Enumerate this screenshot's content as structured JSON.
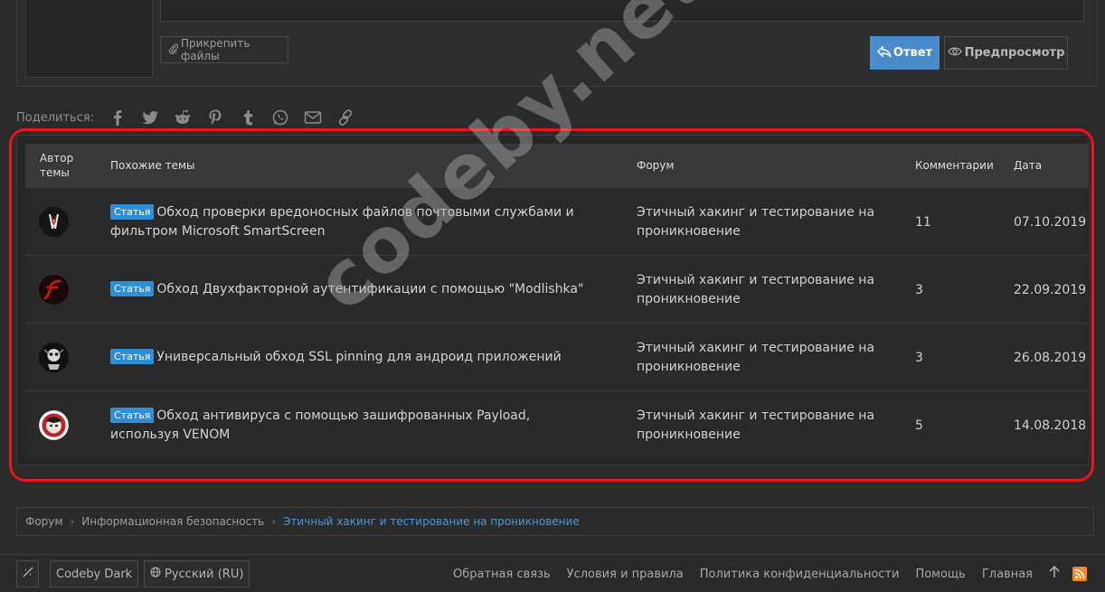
{
  "reply": {
    "attach_label": "Прикрепить файлы",
    "reply_label": "Ответ",
    "preview_label": "Предпросмотр"
  },
  "share": {
    "label": "Поделиться:",
    "icons": [
      "facebook-icon",
      "twitter-icon",
      "reddit-icon",
      "pinterest-icon",
      "tumblr-icon",
      "whatsapp-icon",
      "email-icon",
      "link-icon"
    ]
  },
  "similar": {
    "headers": {
      "author": "Автор темы",
      "title": "Похожие темы",
      "forum": "Форум",
      "comments": "Комментарии",
      "date": "Дата"
    },
    "rows": [
      {
        "prefix": "Статья",
        "title": "Обход проверки вредоносных файлов почтовыми службами и фильтром Microsoft SmartScreen",
        "forum": "Этичный хакинг и тестирование на проникновение",
        "comments": "11",
        "date": "07.10.2019"
      },
      {
        "prefix": "Статья",
        "title": "Обход Двухфакторной аутентификации с помощью \"Modlishka\"",
        "forum": "Этичный хакинг и тестирование на проникновение",
        "comments": "3",
        "date": "22.09.2019"
      },
      {
        "prefix": "Статья",
        "title": "Универсальный обход SSL pinning для андроид приложений",
        "forum": "Этичный хакинг и тестирование на проникновение",
        "comments": "3",
        "date": "26.08.2019"
      },
      {
        "prefix": "Статья",
        "title": "Обход антивируса с помощью зашифрованных Payload, используя VENOM",
        "forum": "Этичный хакинг и тестирование на проникновение",
        "comments": "5",
        "date": "14.08.2018"
      }
    ]
  },
  "watermark": "codeby.net",
  "breadcrumb": {
    "items": [
      "Форум",
      "Информационная безопасность"
    ],
    "current": "Этичный хакинг и тестирование на проникновение"
  },
  "footer": {
    "style_label": "Codeby Dark",
    "language_label": "Русский (RU)",
    "links": [
      "Обратная связь",
      "Условия и правила",
      "Политика конфиденциальности",
      "Помощь",
      "Главная"
    ]
  },
  "colors": {
    "accent": "#4a8cc9",
    "highlight": "#e8141e",
    "badge": "#2f8fd6"
  }
}
